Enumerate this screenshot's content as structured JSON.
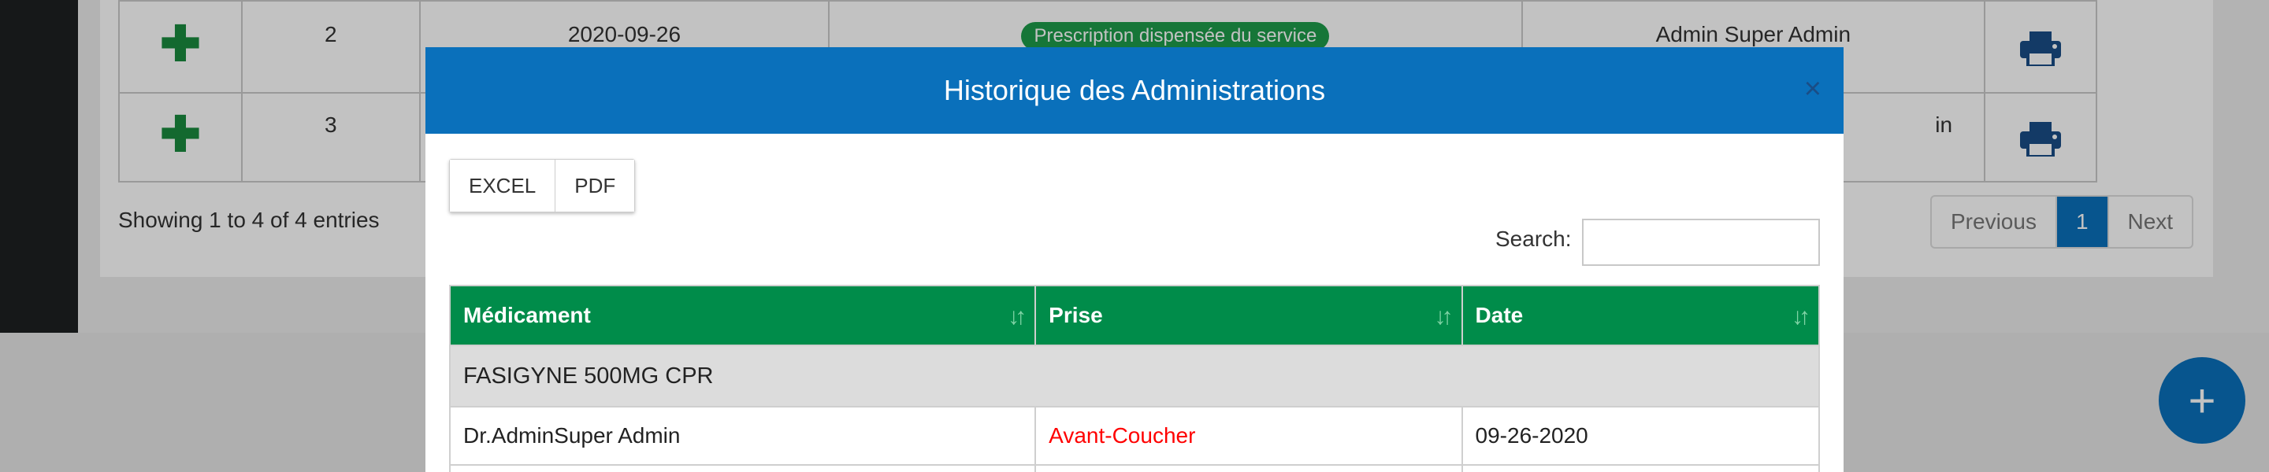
{
  "background": {
    "rows": [
      {
        "number": "2",
        "date": "2020-09-26",
        "status": "Prescription dispensée du service",
        "user": "Admin Super Admin"
      },
      {
        "number": "3",
        "date": "",
        "status": "",
        "user": "in"
      }
    ],
    "info": "Showing 1 to 4 of 4 entries",
    "pagination": {
      "previous": "Previous",
      "current": "1",
      "next": "Next"
    },
    "fab_label": "+"
  },
  "modal": {
    "title": "Historique des Administrations",
    "close": "×",
    "export_buttons": [
      "EXCEL",
      "PDF"
    ],
    "search_label": "Search:",
    "search_value": "",
    "columns": [
      "Médicament",
      "Prise",
      "Date"
    ],
    "groups": [
      {
        "name": "FASIGYNE 500MG CPR",
        "rows": [
          {
            "medicament": "Dr.AdminSuper Admin",
            "prise": "Avant-Coucher",
            "date": "09-26-2020"
          }
        ]
      }
    ]
  },
  "colors": {
    "header_blue": "#0a70bb",
    "table_header_green": "#008c4a",
    "prise_red": "#ff0000",
    "badge_green": "#1d9b4a"
  }
}
